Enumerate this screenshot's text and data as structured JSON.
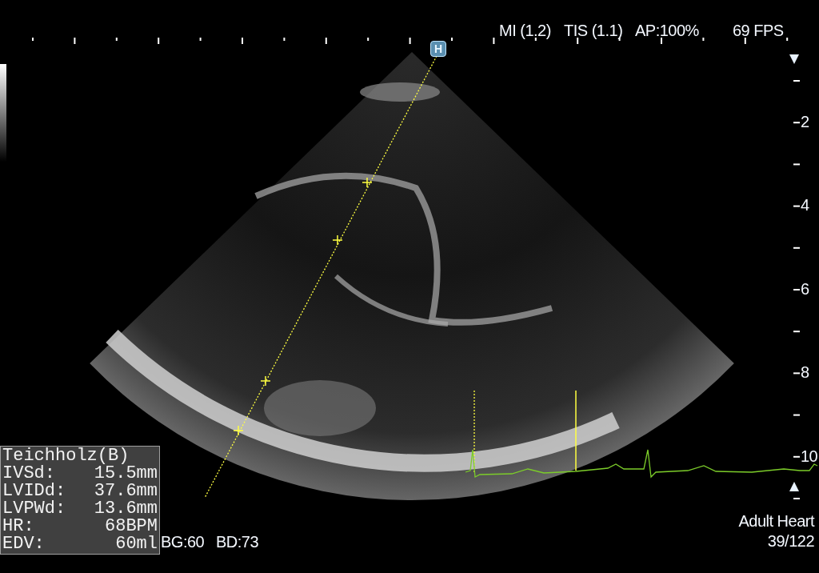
{
  "status_bar": {
    "mi": "MI (1.2)",
    "tis": "TIS (1.1)",
    "ap": "AP:100%",
    "fps": "69 FPS"
  },
  "probe_marker": "H",
  "depth_scale": {
    "labels": [
      "2",
      "4",
      "6",
      "8",
      "10"
    ]
  },
  "measurements": {
    "title": "Teichholz(B)",
    "rows": [
      {
        "label": "IVSd:",
        "value": "15.5mm"
      },
      {
        "label": "LVIDd:",
        "value": "37.6mm"
      },
      {
        "label": "LVPWd:",
        "value": "13.6mm"
      },
      {
        "label": "HR:",
        "value": "68BPM"
      },
      {
        "label": "EDV:",
        "value": "60ml"
      }
    ]
  },
  "gain": {
    "bg": "BG:60",
    "bd": "BD:73"
  },
  "preset": "Adult Heart",
  "frame_counter": "39/122"
}
